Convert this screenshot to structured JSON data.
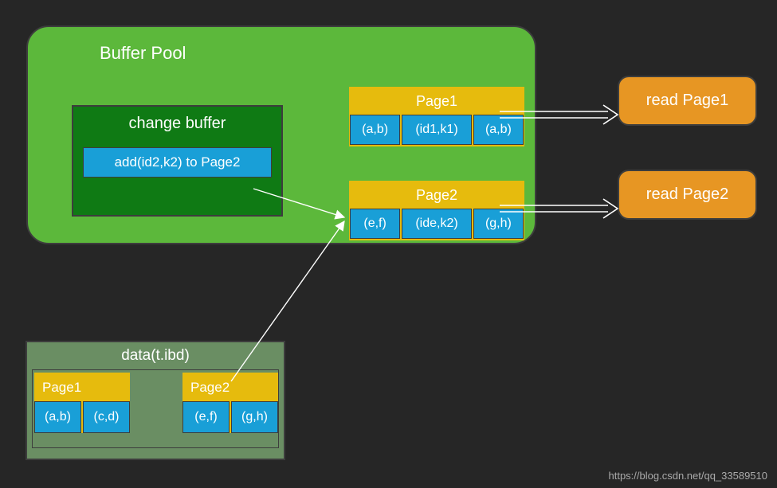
{
  "buffer_pool": {
    "title": "Buffer Pool",
    "change_buffer": {
      "title": "change buffer",
      "entry": "add(id2,k2) to Page2"
    },
    "page1": {
      "title": "Page1",
      "cells": [
        "(a,b)",
        "(id1,k1)",
        "(a,b)"
      ]
    },
    "page2": {
      "title": "Page2",
      "cells": [
        "(e,f)",
        "(ide,k2)",
        "(g,h)"
      ]
    }
  },
  "reads": {
    "read1": "read Page1",
    "read2": "read Page2"
  },
  "data_file": {
    "title": "data(t.ibd)",
    "page1": {
      "title": "Page1",
      "cells": [
        "(a,b)",
        "(c,d)"
      ]
    },
    "page2": {
      "title": "Page2",
      "cells": [
        "(e,f)",
        "(g,h)"
      ]
    }
  },
  "watermark": "https://blog.csdn.net/qq_33589510",
  "colors": {
    "bg": "#262626",
    "green": "#5cb83b",
    "green_dark": "#0f7a14",
    "green_olive": "#6a8e63",
    "yellow": "#e6bb0d",
    "blue": "#199fd7",
    "orange": "#e79623"
  },
  "chart_data": {
    "type": "diagram",
    "title": "Buffer Pool / Change Buffer interaction with data file",
    "nodes": [
      {
        "id": "buffer_pool",
        "label": "Buffer Pool",
        "children": [
          "change_buffer",
          "bp_page1",
          "bp_page2"
        ]
      },
      {
        "id": "change_buffer",
        "label": "change buffer",
        "entries": [
          "add(id2,k2) to Page2"
        ]
      },
      {
        "id": "bp_page1",
        "label": "Page1",
        "cells": [
          "(a,b)",
          "(id1,k1)",
          "(a,b)"
        ]
      },
      {
        "id": "bp_page2",
        "label": "Page2",
        "cells": [
          "(e,f)",
          "(ide,k2)",
          "(g,h)"
        ]
      },
      {
        "id": "data_file",
        "label": "data(t.ibd)",
        "children": [
          "df_page1",
          "df_page2"
        ]
      },
      {
        "id": "df_page1",
        "label": "Page1",
        "cells": [
          "(a,b)",
          "(c,d)"
        ]
      },
      {
        "id": "df_page2",
        "label": "Page2",
        "cells": [
          "(e,f)",
          "(g,h)"
        ]
      },
      {
        "id": "read1",
        "label": "read Page1"
      },
      {
        "id": "read2",
        "label": "read Page2"
      }
    ],
    "edges": [
      {
        "from": "change_buffer",
        "to": "bp_page2",
        "style": "thin-arrow"
      },
      {
        "from": "df_page2",
        "to": "bp_page2",
        "style": "thin-arrow"
      },
      {
        "from": "bp_page1",
        "to": "read1",
        "style": "double-arrow"
      },
      {
        "from": "bp_page2",
        "to": "read2",
        "style": "double-arrow"
      }
    ]
  }
}
